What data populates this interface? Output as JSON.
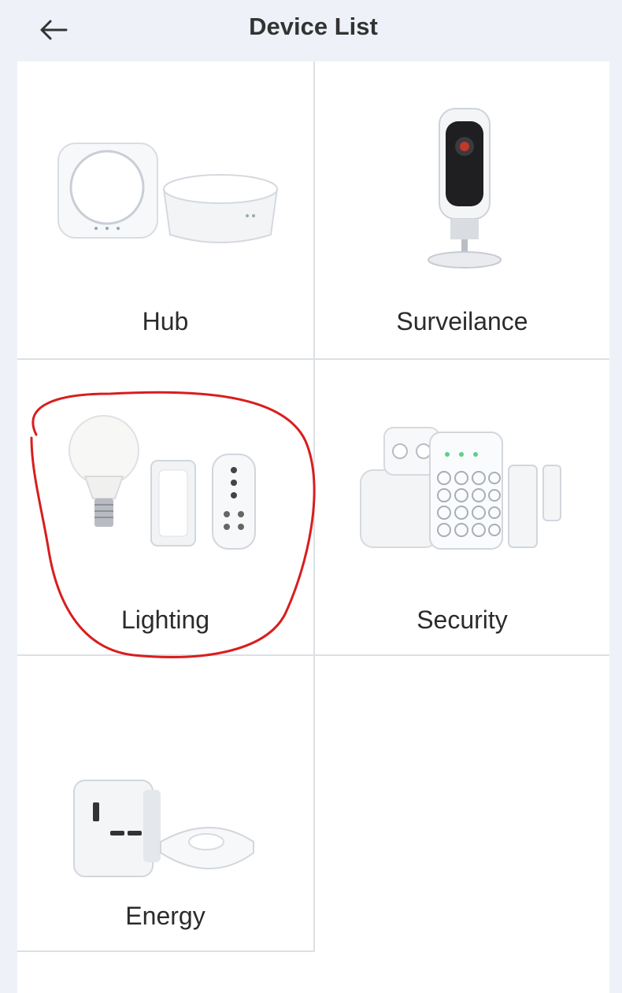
{
  "header": {
    "title": "Device List",
    "back_icon": "back-arrow-icon"
  },
  "categories": [
    {
      "label": "Hub",
      "icon": "hub-device-icon"
    },
    {
      "label": "Surveilance",
      "icon": "camera-device-icon"
    },
    {
      "label": "Lighting",
      "icon": "lighting-device-icon"
    },
    {
      "label": "Security",
      "icon": "security-device-icon"
    },
    {
      "label": "Energy",
      "icon": "energy-device-icon"
    }
  ],
  "annotation": {
    "color": "#d81e1e",
    "target": "Lighting"
  }
}
